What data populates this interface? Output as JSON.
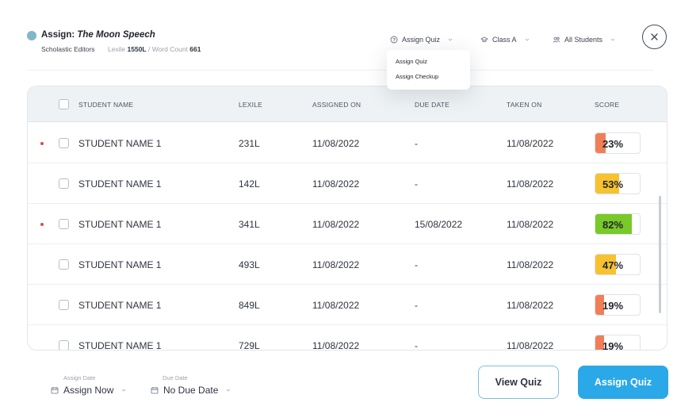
{
  "header": {
    "assign_prefix": "Assign: ",
    "title": "The Moon Speech",
    "publisher": "Scholastic Editors",
    "lexile_label": "Lexile ",
    "lexile_value": "1550L",
    "word_count_label": " / Word Count ",
    "word_count_value": "661",
    "dot_color": "#7fb8c8"
  },
  "filters": {
    "assign_type": {
      "label": "Assign Quiz",
      "icon": "quiz-icon"
    },
    "class": {
      "label": "Class A",
      "icon": "class-icon"
    },
    "students": {
      "label": "All Students",
      "icon": "students-icon"
    }
  },
  "assign_menu": {
    "options": [
      "Assign Quiz",
      "Assign Checkup"
    ]
  },
  "table": {
    "columns": [
      "STUDENT NAME",
      "LEXILE",
      "ASSIGNED ON",
      "DUE DATE",
      "TAKEN ON",
      "SCORE"
    ],
    "rows": [
      {
        "flagged": true,
        "name": "STUDENT NAME 1",
        "lexile": "231L",
        "assigned_on": "11/08/2022",
        "due_date": "-",
        "taken_on": "11/08/2022",
        "score": "23%",
        "score_value": 0.23,
        "score_color": "#f07f57"
      },
      {
        "flagged": false,
        "name": "STUDENT NAME 1",
        "lexile": "142L",
        "assigned_on": "11/08/2022",
        "due_date": "-",
        "taken_on": "11/08/2022",
        "score": "53%",
        "score_value": 0.53,
        "score_color": "#f7c22d"
      },
      {
        "flagged": true,
        "name": "STUDENT NAME 1",
        "lexile": "341L",
        "assigned_on": "11/08/2022",
        "due_date": "15/08/2022",
        "taken_on": "11/08/2022",
        "score": "82%",
        "score_value": 0.82,
        "score_color": "#79c928"
      },
      {
        "flagged": false,
        "name": "STUDENT NAME 1",
        "lexile": "493L",
        "assigned_on": "11/08/2022",
        "due_date": "-",
        "taken_on": "11/08/2022",
        "score": "47%",
        "score_value": 0.47,
        "score_color": "#f7c22d"
      },
      {
        "flagged": false,
        "name": "STUDENT NAME 1",
        "lexile": "849L",
        "assigned_on": "11/08/2022",
        "due_date": "-",
        "taken_on": "11/08/2022",
        "score": "19%",
        "score_value": 0.19,
        "score_color": "#f07f57"
      },
      {
        "flagged": false,
        "name": "STUDENT NAME 1",
        "lexile": "729L",
        "assigned_on": "11/08/2022",
        "due_date": "-",
        "taken_on": "11/08/2022",
        "score": "19%",
        "score_value": 0.19,
        "score_color": "#f07f57"
      }
    ]
  },
  "footer": {
    "assign_date_label": "Assign Date",
    "assign_date_value": "Assign Now",
    "due_date_label": "Due Date",
    "due_date_value": "No Due Date",
    "view_quiz": "View Quiz",
    "assign_quiz": "Assign Quiz"
  },
  "colors": {
    "primary": "#2aa8e8",
    "outline": "#7cc1dc",
    "flag_dot": "#e14b4b"
  }
}
